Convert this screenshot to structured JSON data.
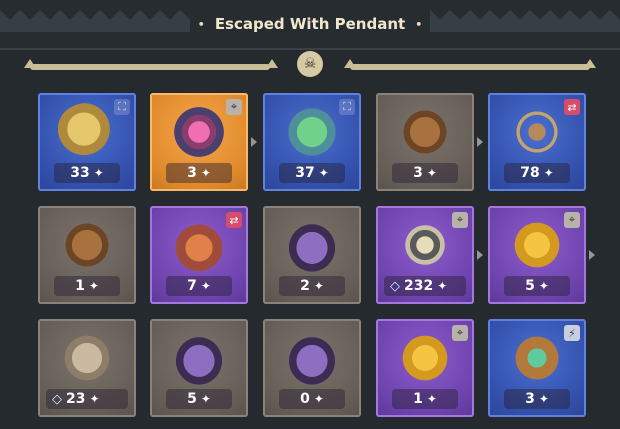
{
  "header": {
    "title": "Escaped With Pendant",
    "dot_left": "•",
    "dot_right": "•"
  },
  "emblem_icon": "skull-emblem-icon",
  "colors": {
    "blue": "#3350ab",
    "orange": "#e08a2c",
    "gray": "#645d56",
    "purple": "#6d43ad",
    "title": "#f1e7cf"
  },
  "rows": [
    [
      {
        "rarity": "blue",
        "icon": "robot-orb-icon",
        "count": "33",
        "badge": "expand",
        "gem": false
      },
      {
        "rarity": "orange",
        "icon": "gem-core-icon",
        "count": "3",
        "badge": "target",
        "gem": false
      },
      {
        "rarity": "blue",
        "icon": "slime-blob-icon",
        "count": "37",
        "badge": "expand",
        "gem": false
      },
      {
        "rarity": "gray",
        "icon": "wooden-box-icon",
        "count": "3",
        "badge": "",
        "gem": false
      },
      {
        "rarity": "blue",
        "icon": "tri-necklace-icon",
        "count": "78",
        "badge": "swap",
        "gem": false
      }
    ],
    [
      {
        "rarity": "gray",
        "icon": "wooden-box-icon",
        "count": "1",
        "badge": "",
        "gem": false
      },
      {
        "rarity": "purple",
        "icon": "pendant-icon",
        "count": "7",
        "badge": "swap",
        "gem": false
      },
      {
        "rarity": "gray",
        "icon": "glove-icon",
        "count": "2",
        "badge": "",
        "gem": false
      },
      {
        "rarity": "purple",
        "icon": "lightning-rune-icon",
        "count": "232",
        "badge": "target",
        "gem": true
      },
      {
        "rarity": "purple",
        "icon": "golden-wing-icon",
        "count": "5",
        "badge": "target",
        "gem": false
      }
    ],
    [
      {
        "rarity": "gray",
        "icon": "bell-icon",
        "count": "23",
        "badge": "",
        "gem": true
      },
      {
        "rarity": "gray",
        "icon": "glove-icon",
        "count": "5",
        "badge": "",
        "gem": false
      },
      {
        "rarity": "gray",
        "icon": "glove-icon",
        "count": "0",
        "badge": "",
        "gem": false
      },
      {
        "rarity": "purple",
        "icon": "golden-wing-icon",
        "count": "1",
        "badge": "target",
        "gem": false
      },
      {
        "rarity": "blue",
        "icon": "potion-urn-icon",
        "count": "3",
        "badge": "bolt",
        "gem": false
      }
    ]
  ]
}
